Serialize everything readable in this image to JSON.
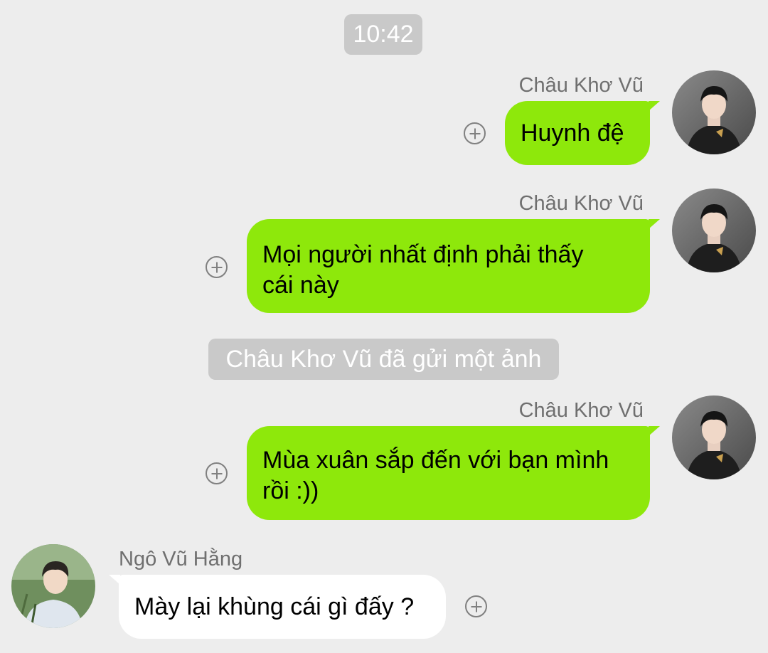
{
  "timestamp": "10:42",
  "messages": [
    {
      "sender": "Châu Khơ Vũ",
      "text_lines": [
        "Huynh đệ"
      ]
    },
    {
      "sender": "Châu Khơ Vũ",
      "text_lines": [
        "Mọi người nhất định phải thấy",
        "cái này"
      ]
    },
    {
      "system": "Châu Khơ Vũ đã gửi một ảnh"
    },
    {
      "sender": "Châu Khơ Vũ",
      "text_lines": [
        "Mùa xuân sắp đến với bạn mình",
        "rồi :))"
      ]
    },
    {
      "sender": "Ngô Vũ Hằng",
      "text_lines": [
        "Mày lại khùng cái gì đấy ?"
      ]
    }
  ],
  "colors": {
    "background": "#ededed",
    "outgoing_bubble": "#8ee80b",
    "incoming_bubble": "#ffffff",
    "pill": "#c9c9c9",
    "sender_text": "#6f6f6f"
  },
  "icons": {
    "reaction": "plus-circle-icon",
    "avatar_outgoing": "avatar",
    "avatar_incoming": "avatar"
  }
}
